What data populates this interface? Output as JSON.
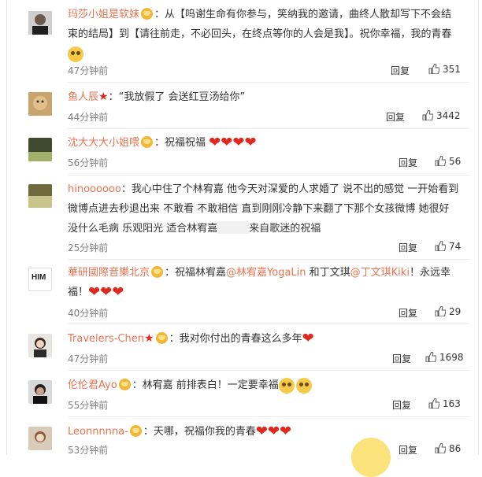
{
  "comments": [
    {
      "user": "玛莎小姐是软妹",
      "text1": "：从【呜谢生命有你参与，笑纳我的邀请，曲终人散却写下不会结",
      "text2": "束的结局】到【请往前走，不必回头，在终点等你的人会是我】。祝你幸福，我的青春",
      "time": "47分钟前",
      "reply": "回复",
      "likes": "351"
    },
    {
      "user": "鱼人辰",
      "text1": "：“我放假了 会送红豆汤给你”",
      "time": "44分钟前",
      "reply": "回复",
      "likes": "3442"
    },
    {
      "user": "沈大大大小姐喂",
      "text1": "：祝福祝福",
      "time": "56分钟前",
      "reply": "回复",
      "likes": "56"
    },
    {
      "user": "hinoooooo",
      "text1": "：我心中住了个林宥嘉 他今天对深爱的人求婚了 说不出的感觉 一开始看到",
      "text2": "微博点进去秒退出来 不敢看 不敢相信 直到刚刚冷静下来翻了下那个女孩微博 她很好",
      "text3a": "没什么毛病 乐观阳光 适合林宥嘉",
      "text3b": "来自歌迷的祝福",
      "time": "25分钟前",
      "reply": "回复",
      "likes": "74"
    },
    {
      "user": "華研國際音樂北京",
      "text1a": "：祝福林宥嘉",
      "mention1": "@林宥嘉YogaLin",
      "text1b": " 和丁文琪",
      "mention2": "@丁文琪Kiki",
      "text1c": "！永远幸",
      "text2": "福！",
      "time": "40分钟前",
      "reply": "回复",
      "likes": "29"
    },
    {
      "user": "Travelers-Chen",
      "text1": "：我对你付出的青春这么多年",
      "time": "47分钟前",
      "reply": "回复",
      "likes": "1698"
    },
    {
      "user": "伦伦君Ayo",
      "text1": "：林宥嘉 前排表白！一定要幸福",
      "time": "55分钟前",
      "reply": "回复",
      "likes": "163"
    },
    {
      "user": "Leonnnnna-",
      "text1": "：天哪，祝福你我的青春",
      "time": "53分钟前",
      "reply": "回复",
      "likes": "86"
    }
  ],
  "avatar_labels": {
    "him": "HIM"
  },
  "colors": {
    "username": "#eb7350",
    "heart": "#e0281e",
    "meta": "#808080"
  }
}
